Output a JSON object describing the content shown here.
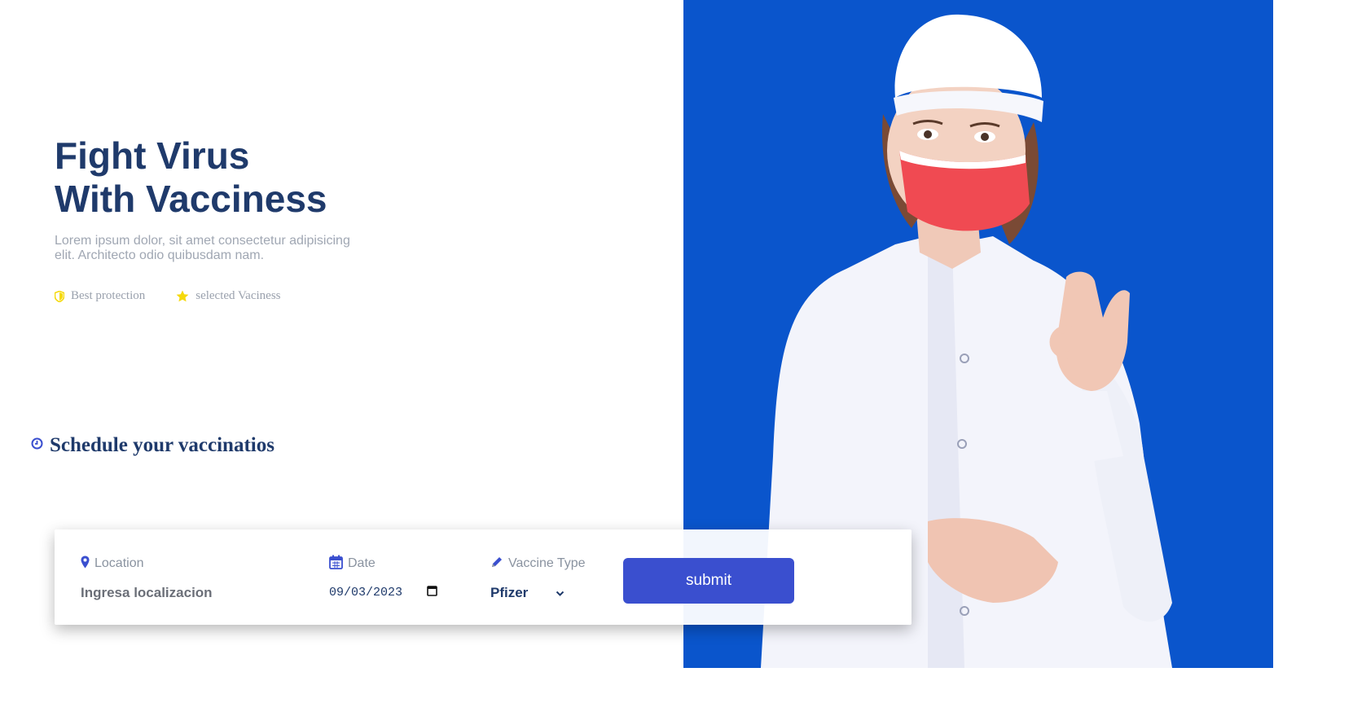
{
  "hero": {
    "title_line1": "Fight Virus",
    "title_line2": "With Vacciness",
    "description": "Lorem ipsum dolor, sit amet consectetur adipisicing elit. Architecto odio quibusdam nam.",
    "features": [
      {
        "icon": "shield-icon",
        "label": "Best protection",
        "icon_color": "#f5d90a"
      },
      {
        "icon": "star-icon",
        "label": "selected Vaciness",
        "icon_color": "#f5d90a"
      }
    ]
  },
  "schedule": {
    "icon": "clock-icon",
    "title": "Schedule your vaccinatios"
  },
  "form": {
    "location": {
      "icon": "map-pin-icon",
      "label": "Location",
      "placeholder": "Ingresa localizacion"
    },
    "date": {
      "icon": "calendar-icon",
      "label": "Date",
      "value": "09/03/2023"
    },
    "vaccine_type": {
      "icon": "pencil-icon",
      "label": "Vaccine Type",
      "selected": "Pfizer"
    },
    "submit_label": "submit"
  },
  "colors": {
    "title": "#1f3a6b",
    "accent": "#3a4fcf",
    "photo_background": "#0a55cc"
  }
}
